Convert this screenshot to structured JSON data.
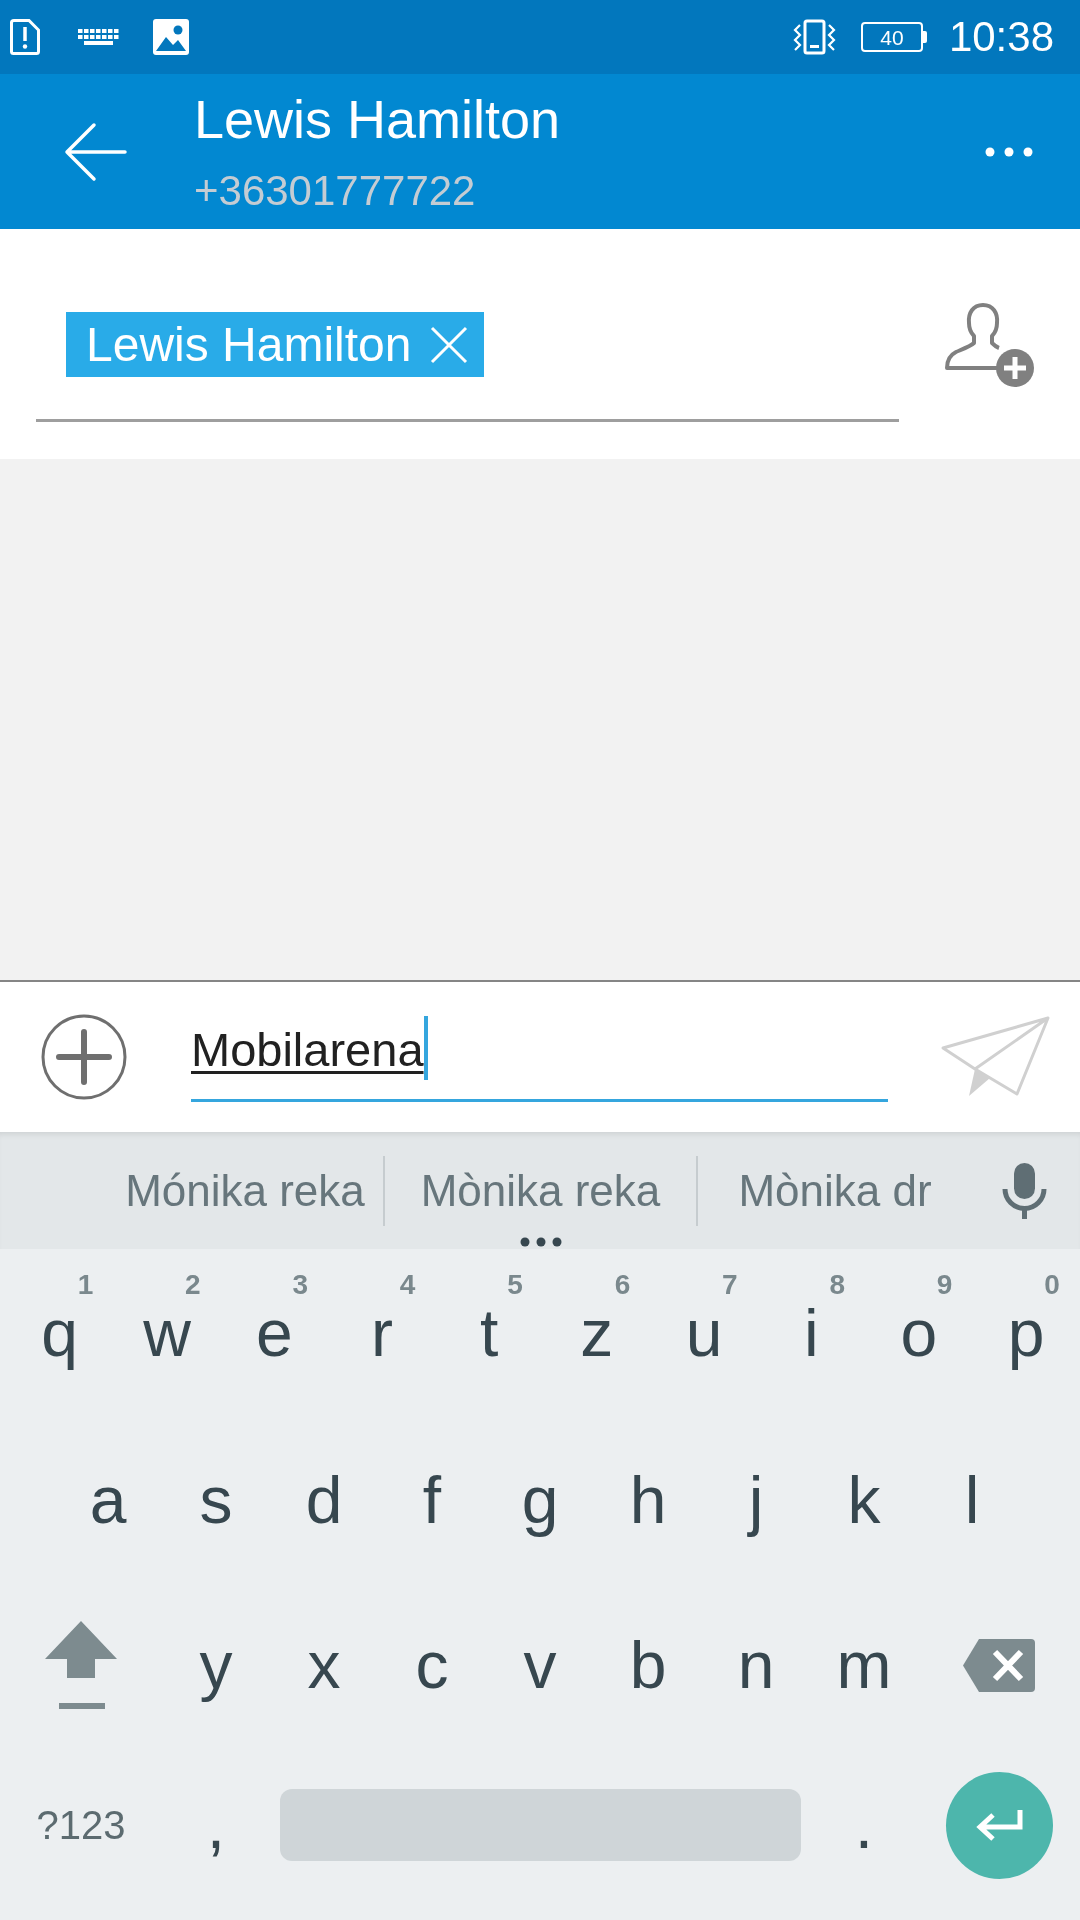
{
  "status_bar": {
    "battery": "40",
    "time": "10:38"
  },
  "app_bar": {
    "title": "Lewis Hamilton",
    "subtitle": "+36301777722"
  },
  "recipients": [
    {
      "name": "Lewis Hamilton"
    }
  ],
  "compose": {
    "value": "Mobilarena",
    "composing": true
  },
  "keyboard": {
    "suggestions": [
      {
        "text": "Mónika reka",
        "more": false
      },
      {
        "text": "Mònika reka",
        "more": true
      },
      {
        "text": "Mònika dr",
        "more": false
      }
    ],
    "rows": [
      [
        {
          "kind": "char",
          "label": "q",
          "hint": "1"
        },
        {
          "kind": "char",
          "label": "w",
          "hint": "2"
        },
        {
          "kind": "char",
          "label": "e",
          "hint": "3"
        },
        {
          "kind": "char",
          "label": "r",
          "hint": "4"
        },
        {
          "kind": "char",
          "label": "t",
          "hint": "5"
        },
        {
          "kind": "char",
          "label": "z",
          "hint": "6"
        },
        {
          "kind": "char",
          "label": "u",
          "hint": "7"
        },
        {
          "kind": "char",
          "label": "i",
          "hint": "8"
        },
        {
          "kind": "char",
          "label": "o",
          "hint": "9"
        },
        {
          "kind": "char",
          "label": "p",
          "hint": "0"
        }
      ],
      [
        {
          "kind": "char",
          "label": "a"
        },
        {
          "kind": "char",
          "label": "s"
        },
        {
          "kind": "char",
          "label": "d"
        },
        {
          "kind": "char",
          "label": "f"
        },
        {
          "kind": "char",
          "label": "g"
        },
        {
          "kind": "char",
          "label": "h"
        },
        {
          "kind": "char",
          "label": "j"
        },
        {
          "kind": "char",
          "label": "k"
        },
        {
          "kind": "char",
          "label": "l"
        }
      ],
      [
        {
          "kind": "shift"
        },
        {
          "kind": "char",
          "label": "y"
        },
        {
          "kind": "char",
          "label": "x"
        },
        {
          "kind": "char",
          "label": "c"
        },
        {
          "kind": "char",
          "label": "v"
        },
        {
          "kind": "char",
          "label": "b"
        },
        {
          "kind": "char",
          "label": "n"
        },
        {
          "kind": "char",
          "label": "m"
        },
        {
          "kind": "backspace"
        }
      ]
    ],
    "bottom_row": [
      {
        "kind": "mode",
        "label": "?123"
      },
      {
        "kind": "char",
        "label": ","
      },
      {
        "kind": "space"
      },
      {
        "kind": "char",
        "label": "."
      },
      {
        "kind": "enter"
      }
    ]
  }
}
